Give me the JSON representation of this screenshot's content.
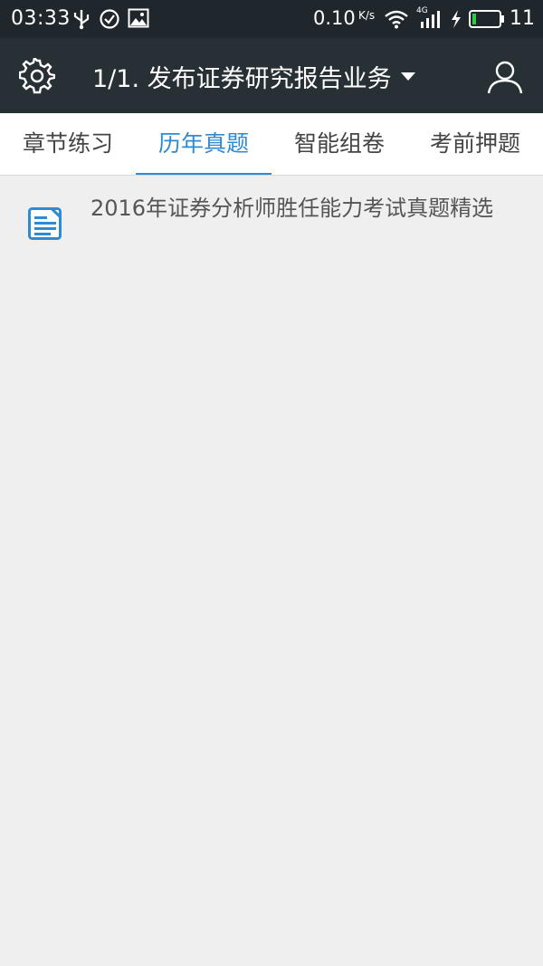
{
  "status_bar": {
    "time": "03:33",
    "network_speed": "0.10",
    "speed_unit": "K/s",
    "network_type": "4G",
    "battery": "11",
    "icons": [
      "usb-icon",
      "check-circle-icon",
      "image-icon",
      "wifi-icon",
      "signal-icon",
      "charging-icon",
      "battery-icon"
    ]
  },
  "app_bar": {
    "title": "1/1. 发布证券研究报告业务",
    "left_icon": "gear-icon",
    "right_icon": "account-icon"
  },
  "tabs": [
    {
      "label": "章节练习",
      "active": false
    },
    {
      "label": "历年真题",
      "active": true
    },
    {
      "label": "智能组卷",
      "active": false
    },
    {
      "label": "考前押题",
      "active": false
    }
  ],
  "list": {
    "items": [
      {
        "title": "2016年证券分析师胜任能力考试真题精选",
        "icon": "document-icon"
      }
    ]
  },
  "colors": {
    "accent": "#2e8bd3",
    "status_bar_bg": "#1f272c",
    "app_bar_bg": "#273035",
    "content_bg": "#efefef"
  }
}
